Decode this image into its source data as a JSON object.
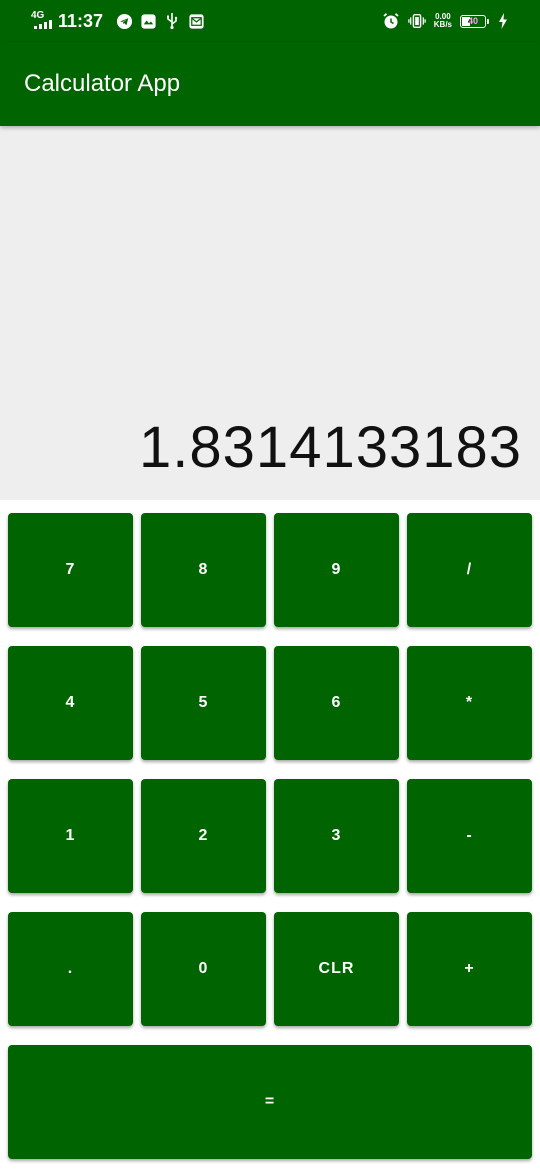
{
  "status_bar": {
    "network": "4G",
    "time": "11:37",
    "left_icons": [
      "telegram-icon",
      "gallery-icon",
      "usb-icon",
      "mail-icon"
    ],
    "right_icons": [
      "alarm-icon",
      "vibrate-icon"
    ],
    "speed_value": "0.00",
    "speed_unit": "KB/s",
    "battery_level": "40",
    "charging": true
  },
  "app_bar": {
    "title": "Calculator App"
  },
  "display": {
    "value": "1.8314133183"
  },
  "keypad": {
    "keys": [
      "7",
      "8",
      "9",
      "/",
      "4",
      "5",
      "6",
      "*",
      "1",
      "2",
      "3",
      "-",
      ".",
      "0",
      "CLR",
      "+"
    ],
    "equals": "="
  },
  "colors": {
    "primary": "#006400",
    "display_background": "#eeeeee",
    "display_text": "#111111",
    "key_text": "#ffffff"
  }
}
